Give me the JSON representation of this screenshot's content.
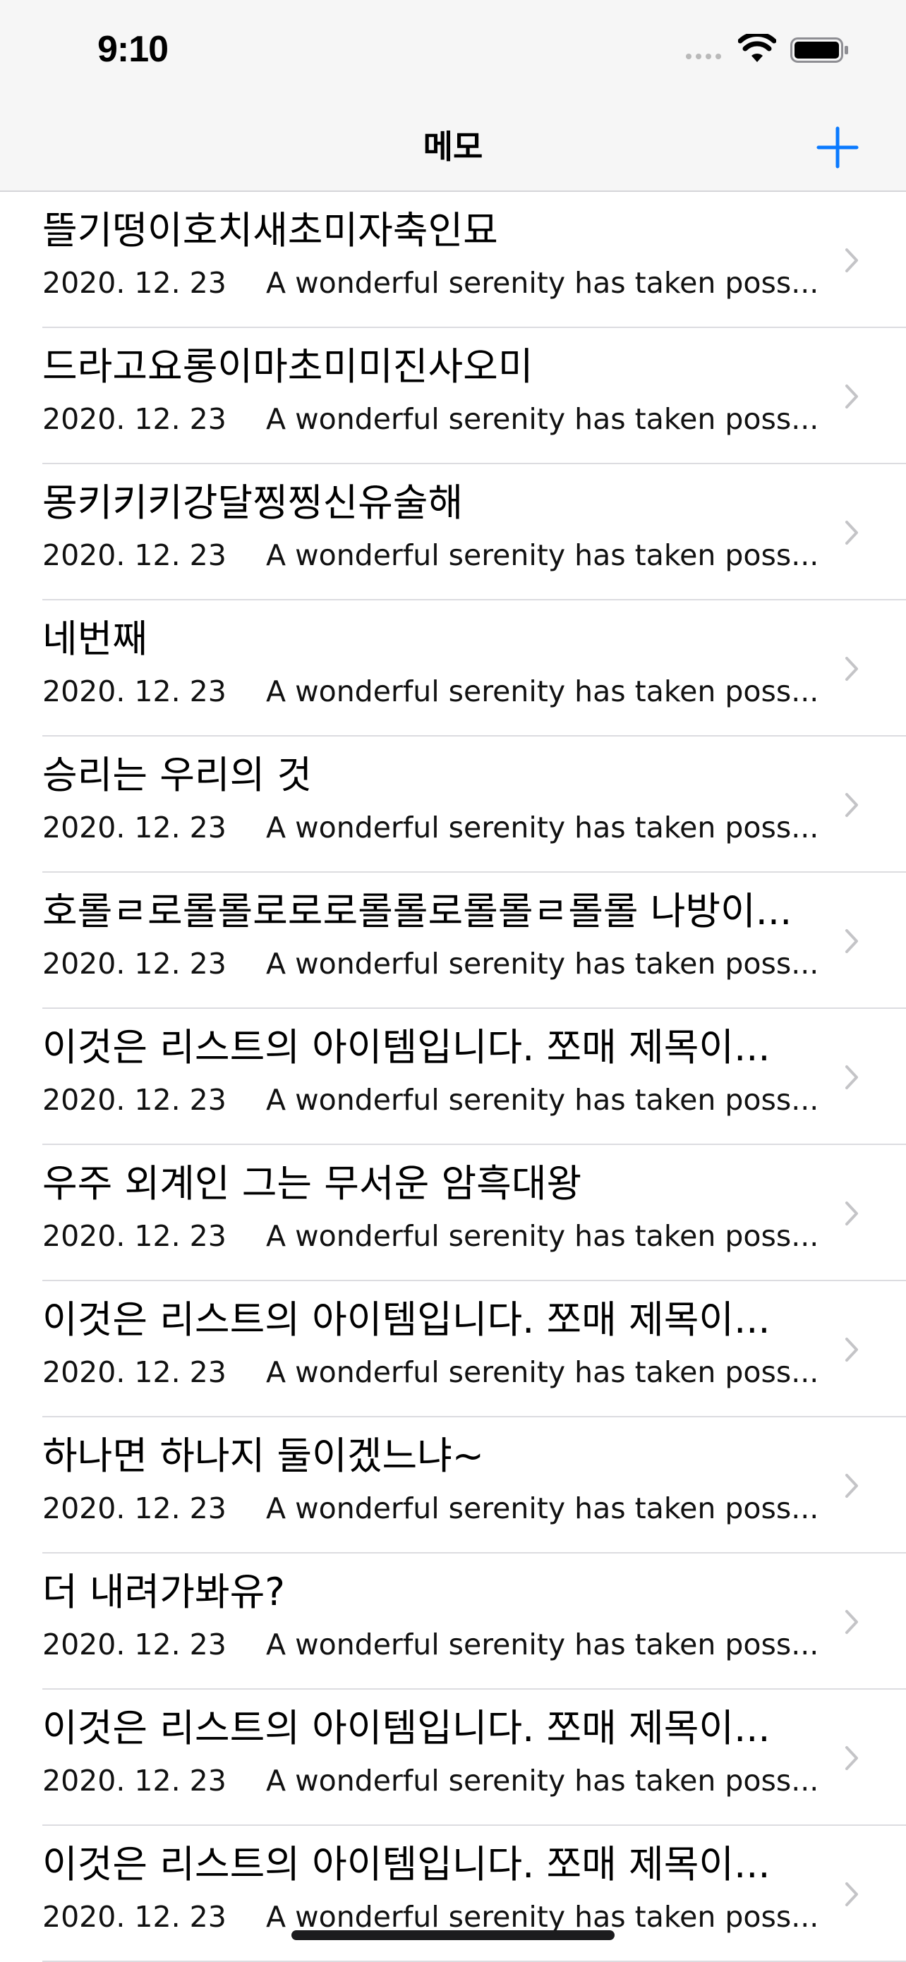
{
  "status_bar": {
    "time": "9:10"
  },
  "navbar": {
    "title": "메모"
  },
  "memos": [
    {
      "title": "뜰기떵이호치새초미자축인묘",
      "date": "2020. 12. 23",
      "preview": "A wonderful serenity has taken poss..."
    },
    {
      "title": "드라고요롱이마초미미진사오미",
      "date": "2020. 12. 23",
      "preview": "A wonderful serenity has taken poss..."
    },
    {
      "title": "몽키키키강달찡찡신유술해",
      "date": "2020. 12. 23",
      "preview": "A wonderful serenity has taken poss..."
    },
    {
      "title": "네번째",
      "date": "2020. 12. 23",
      "preview": "A wonderful serenity has taken poss..."
    },
    {
      "title": "승리는 우리의 것",
      "date": "2020. 12. 23",
      "preview": "A wonderful serenity has taken poss..."
    },
    {
      "title": "호롤ㄹ로롤롤로로로롤롤로롤롤ㄹ롤롤 나방이...",
      "date": "2020. 12. 23",
      "preview": "A wonderful serenity has taken poss..."
    },
    {
      "title": "이것은 리스트의 아이템입니다. 쪼매 제목이...",
      "date": "2020. 12. 23",
      "preview": "A wonderful serenity has taken poss..."
    },
    {
      "title": "우주 외계인 그는 무서운 암흑대왕",
      "date": "2020. 12. 23",
      "preview": "A wonderful serenity has taken poss..."
    },
    {
      "title": "이것은 리스트의 아이템입니다. 쪼매 제목이...",
      "date": "2020. 12. 23",
      "preview": "A wonderful serenity has taken poss..."
    },
    {
      "title": "하나면 하나지 둘이겠느냐~",
      "date": "2020. 12. 23",
      "preview": "A wonderful serenity has taken poss..."
    },
    {
      "title": "더 내려가봐유?",
      "date": "2020. 12. 23",
      "preview": "A wonderful serenity has taken poss..."
    },
    {
      "title": "이것은 리스트의 아이템입니다. 쪼매 제목이...",
      "date": "2020. 12. 23",
      "preview": "A wonderful serenity has taken poss..."
    },
    {
      "title": "이것은 리스트의 아이템입니다. 쪼매 제목이...",
      "date": "2020. 12. 23",
      "preview": "A wonderful serenity has taken poss..."
    }
  ],
  "icons": {
    "add": "plus-icon",
    "row": "chevron-right-icon",
    "status": [
      "cellular-signal-icon",
      "wifi-icon",
      "battery-icon"
    ]
  },
  "colors": {
    "accent": "#0a7aff",
    "chevron": "#c4c4c7",
    "bar_background": "#f6f6f6"
  }
}
